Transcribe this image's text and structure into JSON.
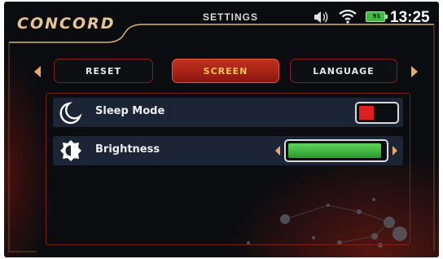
{
  "header": {
    "brand": "CONCORD",
    "title": "SETTINGS",
    "battery_level": "91",
    "time": "13:25"
  },
  "tabs": [
    {
      "label": "RESET",
      "active": false
    },
    {
      "label": "SCREEN",
      "active": true
    },
    {
      "label": "LANGUAGE",
      "active": false
    }
  ],
  "settings": {
    "sleep_mode": {
      "label": "Sleep Mode",
      "icon": "moon-icon",
      "enabled": true
    },
    "brightness": {
      "label": "Brightness",
      "icon": "brightness-icon",
      "level": 0.97
    }
  },
  "colors": {
    "accent": "#c3321f",
    "active_tab_text": "#f2c25a",
    "row_bg": "#1b2536",
    "slider_green": "#4cbf46",
    "toggle_red": "#e02020",
    "frame_gold": "#d9b27c"
  }
}
